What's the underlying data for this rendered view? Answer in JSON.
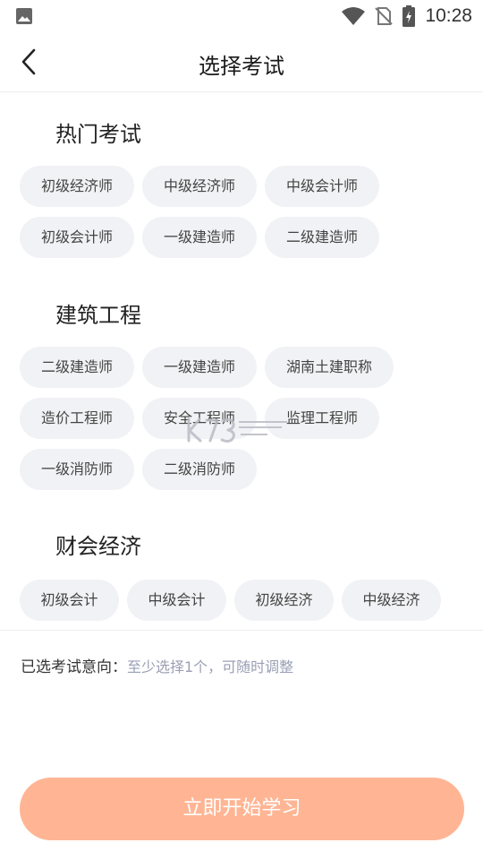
{
  "status_bar": {
    "time": "10:28"
  },
  "header": {
    "title": "选择考试"
  },
  "sections": [
    {
      "title": "热门考试",
      "items": [
        "初级经济师",
        "中级经济师",
        "中级会计师",
        "初级会计师",
        "一级建造师",
        "二级建造师"
      ]
    },
    {
      "title": "建筑工程",
      "items": [
        "二级建造师",
        "一级建造师",
        "湖南土建职称",
        "造价工程师",
        "安全工程师",
        "监理工程师",
        "一级消防师",
        "二级消防师"
      ]
    },
    {
      "title": "财会经济",
      "items": [
        "初级会计",
        "中级会计",
        "初级经济",
        "中级经济"
      ]
    }
  ],
  "selection": {
    "label": "已选考试意向：",
    "hint": "至少选择1个，可随时调整"
  },
  "cta": {
    "label": "立即开始学习"
  },
  "colors": {
    "chip_bg": "#f1f2f5",
    "cta_bg": "#ffb594",
    "hint": "#9a9fb4"
  }
}
